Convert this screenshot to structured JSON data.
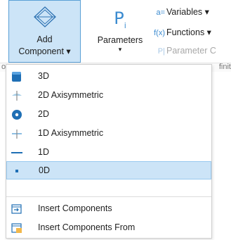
{
  "ribbon": {
    "add_component": {
      "line1": "Add",
      "line2": "Component ▾"
    },
    "parameters": {
      "glyph": "P",
      "glyph_sub": "i",
      "label": "Parameters",
      "arrow": "▾"
    },
    "links": [
      {
        "glyph": "a=",
        "label": "Variables ▾",
        "enabled": true
      },
      {
        "glyph": "f(x)",
        "label": "Functions ▾",
        "enabled": true
      },
      {
        "glyph": "P|",
        "label": "Parameter C",
        "enabled": false
      }
    ],
    "strip_left": "o",
    "strip_right": "finit"
  },
  "menu": {
    "items": [
      {
        "label": "3D",
        "icon": "3d-cube-icon"
      },
      {
        "label": "2D Axisymmetric",
        "icon": "2d-axisymmetric-icon"
      },
      {
        "label": "2D",
        "icon": "2d-icon"
      },
      {
        "label": "1D Axisymmetric",
        "icon": "1d-axisymmetric-icon"
      },
      {
        "label": "1D",
        "icon": "1d-line-icon"
      },
      {
        "label": "0D",
        "icon": "0d-point-icon",
        "selected": true
      },
      {
        "label": "Insert Components",
        "icon": "insert-components-icon"
      },
      {
        "label": "Insert Components From",
        "icon": "insert-components-from-icon"
      }
    ]
  },
  "colors": {
    "accent": "#3b8bd0",
    "selection": "#cce4f7",
    "selection_border": "#99c9ef"
  }
}
